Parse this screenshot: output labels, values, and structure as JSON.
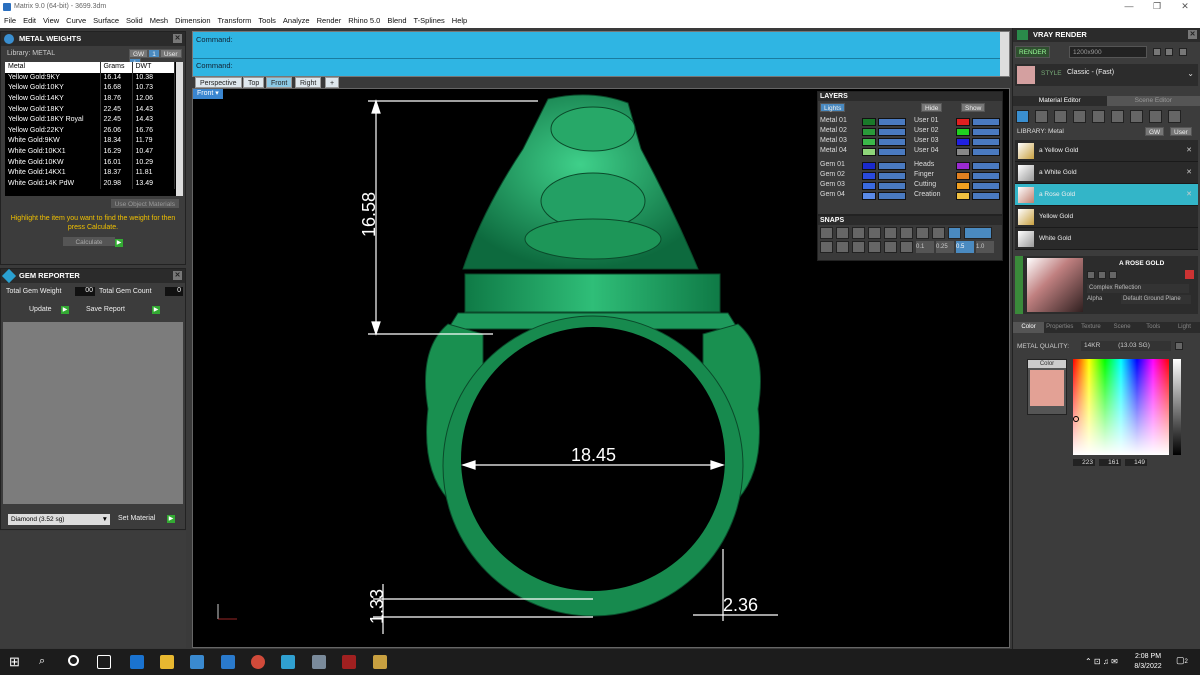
{
  "window": {
    "title": "Matrix 9.0 (64-bit) - 3699.3dm",
    "controls": [
      "—",
      "❐",
      "✕"
    ]
  },
  "menu": [
    "File",
    "Edit",
    "View",
    "Curve",
    "Surface",
    "Solid",
    "Mesh",
    "Dimension",
    "Transform",
    "Tools",
    "Analyze",
    "Render",
    "Rhino 5.0",
    "Blend",
    "T-Splines",
    "Help"
  ],
  "metal_weights": {
    "title": "METAL WEIGHTS",
    "library_label": "Library: METAL",
    "gw": "GW",
    "user": "User",
    "columns": [
      "Metal",
      "Grams",
      "DWT"
    ],
    "rows": [
      [
        "Yellow Gold:9KY",
        "16.14",
        "10.38"
      ],
      [
        "Yellow Gold:10KY",
        "16.68",
        "10.73"
      ],
      [
        "Yellow Gold:14KY",
        "18.76",
        "12.06"
      ],
      [
        "Yellow Gold:18KY",
        "22.45",
        "14.43"
      ],
      [
        "Yellow Gold:18KY Royal",
        "22.45",
        "14.43"
      ],
      [
        "Yellow Gold:22KY",
        "26.06",
        "16.76"
      ],
      [
        "White Gold:9KW",
        "18.34",
        "11.79"
      ],
      [
        "White Gold:10KX1",
        "16.29",
        "10.47"
      ],
      [
        "White Gold:10KW",
        "16.01",
        "10.29"
      ],
      [
        "White Gold:14KX1",
        "18.37",
        "11.81"
      ],
      [
        "White Gold:14K PdW",
        "20.98",
        "13.49"
      ]
    ],
    "use_object": "Use Object Materials",
    "hint": "Highlight the item you want to find the weight for then press Calculate.",
    "calculate": "Calculate"
  },
  "gem_reporter": {
    "title": "GEM REPORTER",
    "total_weight_label": "Total Gem Weight",
    "total_weight": "00",
    "total_count_label": "Total Gem Count",
    "total_count": "0",
    "update": "Update",
    "save_report": "Save Report",
    "gem_select": "Diamond    (3.52 sg)",
    "set_material": "Set Material"
  },
  "command": {
    "line1": "Command:",
    "line2": "Command:"
  },
  "view_tabs": [
    "Perspective",
    "Top",
    "Front",
    "Right"
  ],
  "active_tab": "Front",
  "viewport_label": "Front",
  "dimensions": {
    "height": "16.58",
    "inner": "18.45",
    "band": "1.33",
    "shank": "2.36"
  },
  "layers": {
    "title": "LAYERS",
    "lights": "Lights",
    "hide": "Hide",
    "show": "Show",
    "left": [
      {
        "name": "Metal 01",
        "color": "#1a7a2a"
      },
      {
        "name": "Metal 02",
        "color": "#2a9a3a"
      },
      {
        "name": "Metal 03",
        "color": "#3bb84a"
      },
      {
        "name": "Metal 04",
        "color": "#8fd67a"
      },
      {
        "name": "Gem 01",
        "color": "#1a2acc"
      },
      {
        "name": "Gem 02",
        "color": "#2a4adc"
      },
      {
        "name": "Gem 03",
        "color": "#3a6ae0"
      },
      {
        "name": "Gem 04",
        "color": "#5a8ae8"
      }
    ],
    "right": [
      {
        "name": "User 01",
        "color": "#e02020"
      },
      {
        "name": "User 02",
        "color": "#20d020"
      },
      {
        "name": "User 03",
        "color": "#2020e0"
      },
      {
        "name": "User 04",
        "color": "#888888"
      },
      {
        "name": "Heads",
        "color": "#9a2ad0"
      },
      {
        "name": "Finger",
        "color": "#e08020"
      },
      {
        "name": "Cutting",
        "color": "#f0a020"
      },
      {
        "name": "Creation",
        "color": "#f0c040"
      }
    ]
  },
  "snaps": {
    "title": "SNAPS",
    "values": [
      "0.1",
      "0.25",
      "0.5",
      "1.0"
    ]
  },
  "vray": {
    "title": "VRAY RENDER",
    "render": "RENDER",
    "resolution": "1200x900",
    "style_label": "STYLE",
    "style": "Classic - (Fast)",
    "tabs": [
      "Material Editor",
      "Scene Editor"
    ],
    "library": "LIBRARY: Metal",
    "gw": "GW",
    "user": "User",
    "materials": [
      "a Yellow Gold",
      "a White Gold",
      "a Rose Gold",
      "Yellow Gold",
      "White Gold"
    ],
    "selected_material": "A ROSE GOLD",
    "reflection": "Complex Reflection",
    "alpha": "Alpha",
    "ground": "Default Ground Plane",
    "subtabs": [
      "Color",
      "Properties",
      "Texture",
      "Scene",
      "Tools",
      "Light"
    ],
    "metal_quality_label": "METAL QUALITY:",
    "metal_quality": "14KR",
    "metal_quality_sg": "(13.03 SG)",
    "color_label": "Color",
    "swatch": "#e3a195",
    "rgb": {
      "r": "223",
      "g": "161",
      "b": "149"
    }
  },
  "taskbar": {
    "time": "2:08 PM",
    "date": "8/3/2022",
    "notif": "2"
  }
}
